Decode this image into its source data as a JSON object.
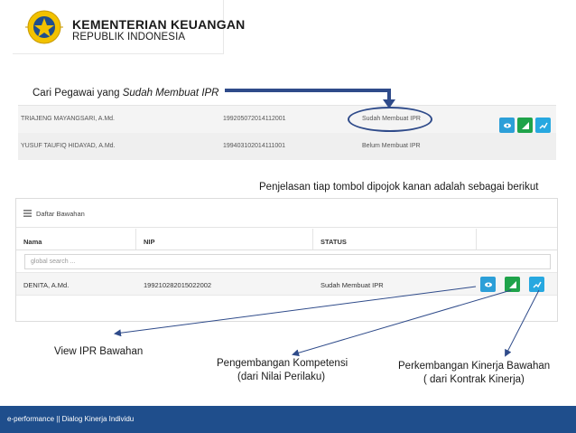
{
  "header": {
    "org_line1": "KEMENTERIAN KEUANGAN",
    "org_line2": "REPUBLIK INDONESIA"
  },
  "callout_search": {
    "text_plain": "Cari Pegawai yang ",
    "text_italic": "Sudah Membuat IPR"
  },
  "top_table": {
    "rows": [
      {
        "name": "TRIAJENG MAYANGSARI, A.Md.",
        "nip": "199205072014112001",
        "status": "Sudah Membuat IPR"
      },
      {
        "name": "YUSUF TAUFIQ HIDAYAD, A.Md.",
        "nip": "199403102014111001",
        "status": "Belum Membuat IPR"
      }
    ]
  },
  "callout_buttons": "Penjelasan tiap tombol dipojok kanan adalah sebagai berikut",
  "panel": {
    "title": "Daftar Bawahan",
    "columns": [
      "Nama",
      "NIP",
      "STATUS"
    ],
    "search_placeholder": "global search ...",
    "row": {
      "name": "DENITA, A.Md.",
      "nip": "199210282015022002",
      "status": "Sudah Membuat IPR"
    }
  },
  "labels": {
    "view": "View IPR Bawahan",
    "pengembangan_line1": "Pengembangan Kompetensi",
    "pengembangan_line2": "(dari Nilai Perilaku)",
    "perkembangan_line1": "Perkembangan Kinerja Bawahan",
    "perkembangan_line2": "( dari Kontrak Kinerja)"
  },
  "footer": "e-performance || Dialog Kinerja Individu",
  "colors": {
    "footer_bg": "#1f4e8c",
    "arrow": "#2f4b8a",
    "button_view": "#2c9fd8",
    "button_kompetensi": "#1fa34a",
    "button_kinerja": "#27a8e0"
  },
  "icons": [
    "emblem-logo",
    "eye-icon",
    "signal-bars-icon",
    "trend-line-icon",
    "list-icon"
  ]
}
